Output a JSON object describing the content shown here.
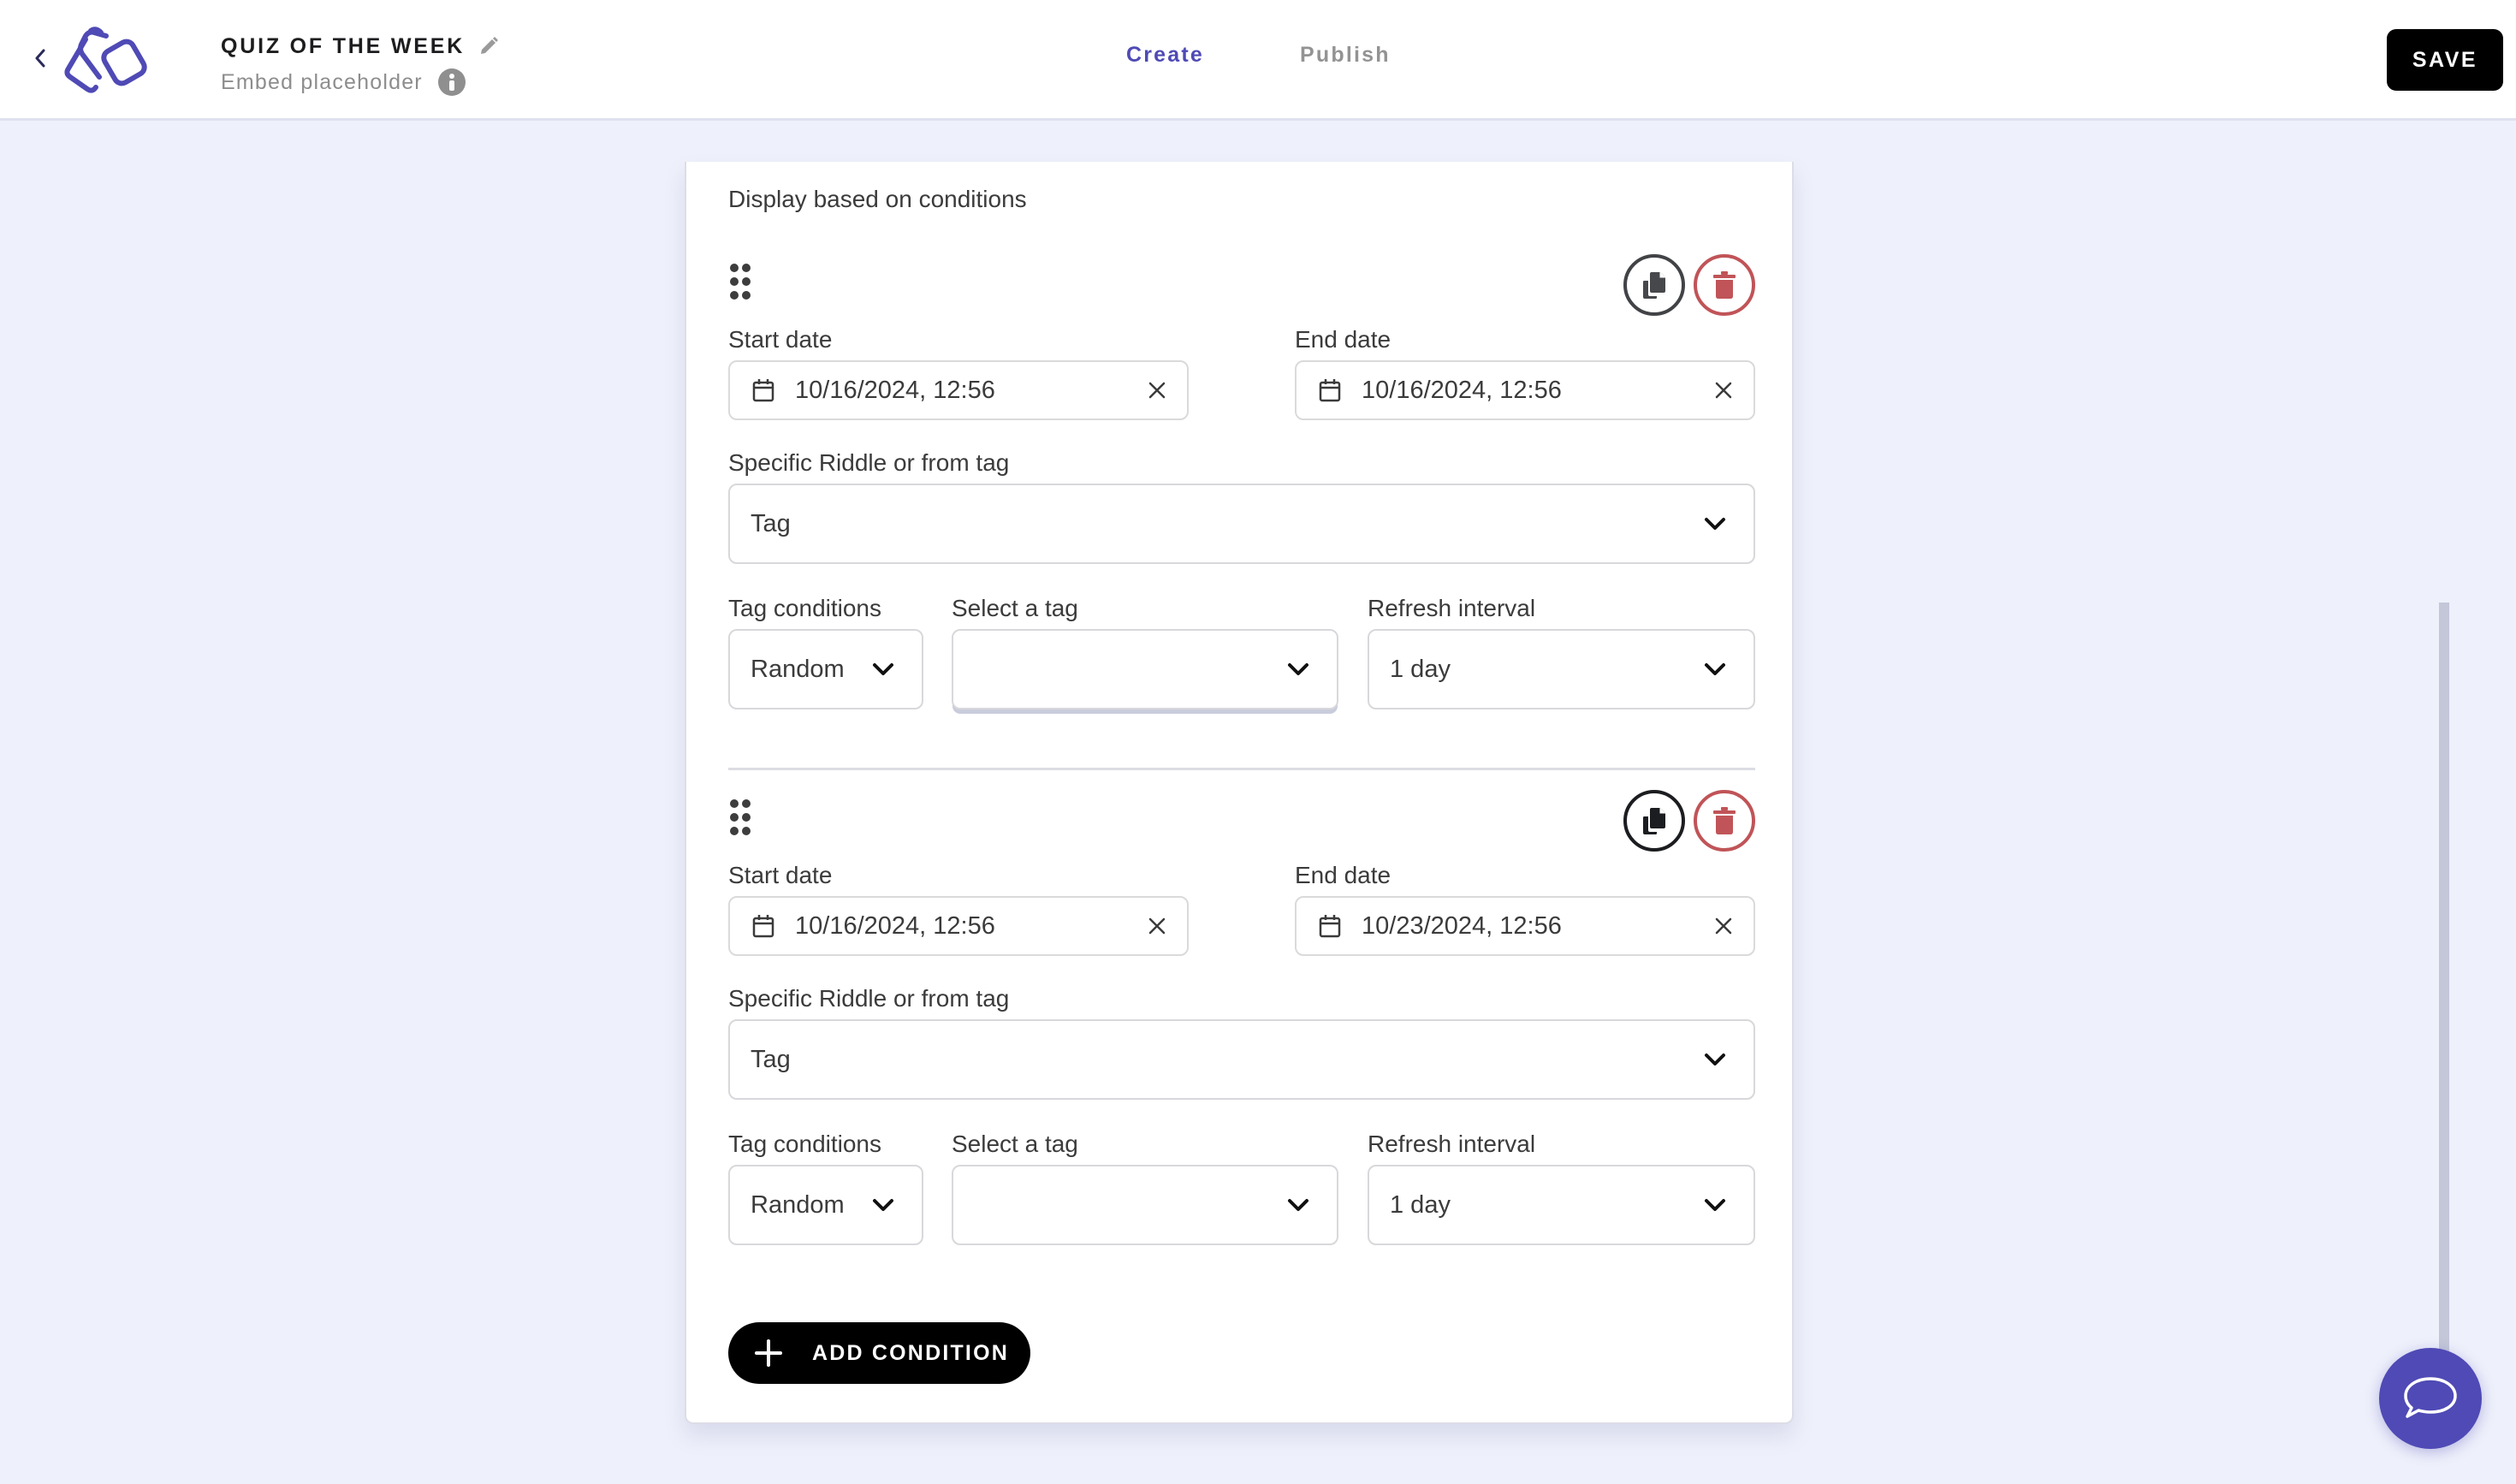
{
  "header": {
    "back_icon": "chevron-left-icon",
    "logo": "app-logo",
    "title": "QUIZ OF THE WEEK",
    "edit_icon": "pencil-icon",
    "subtitle": "Embed placeholder",
    "info_icon": "info-icon",
    "tabs": [
      {
        "label": "Create",
        "active": true
      },
      {
        "label": "Publish",
        "active": false
      }
    ],
    "save_label": "SAVE"
  },
  "colors": {
    "accent": "#4f4ab5",
    "delete": "#c05458",
    "background": "#eef0fb",
    "button_dark": "#000000"
  },
  "section": {
    "title": "Display based on conditions"
  },
  "conditions": [
    {
      "start_date_label": "Start date",
      "start_date": "10/16/2024, 12:56",
      "end_date_label": "End date",
      "end_date": "10/16/2024, 12:56",
      "source_label": "Specific Riddle or from tag",
      "source_value": "Tag",
      "tag_conditions_label": "Tag conditions",
      "tag_conditions_value": "Random",
      "select_tag_label": "Select a tag",
      "select_tag_value": "",
      "refresh_label": "Refresh interval",
      "refresh_value": "1 day"
    },
    {
      "start_date_label": "Start date",
      "start_date": "10/16/2024, 12:56",
      "end_date_label": "End date",
      "end_date": "10/23/2024, 12:56",
      "source_label": "Specific Riddle or from tag",
      "source_value": "Tag",
      "tag_conditions_label": "Tag conditions",
      "tag_conditions_value": "Random",
      "select_tag_label": "Select a tag",
      "select_tag_value": "",
      "refresh_label": "Refresh interval",
      "refresh_value": "1 day"
    }
  ],
  "add_condition_label": "ADD CONDITION",
  "chat": {
    "icon": "chat-bubble-icon"
  }
}
